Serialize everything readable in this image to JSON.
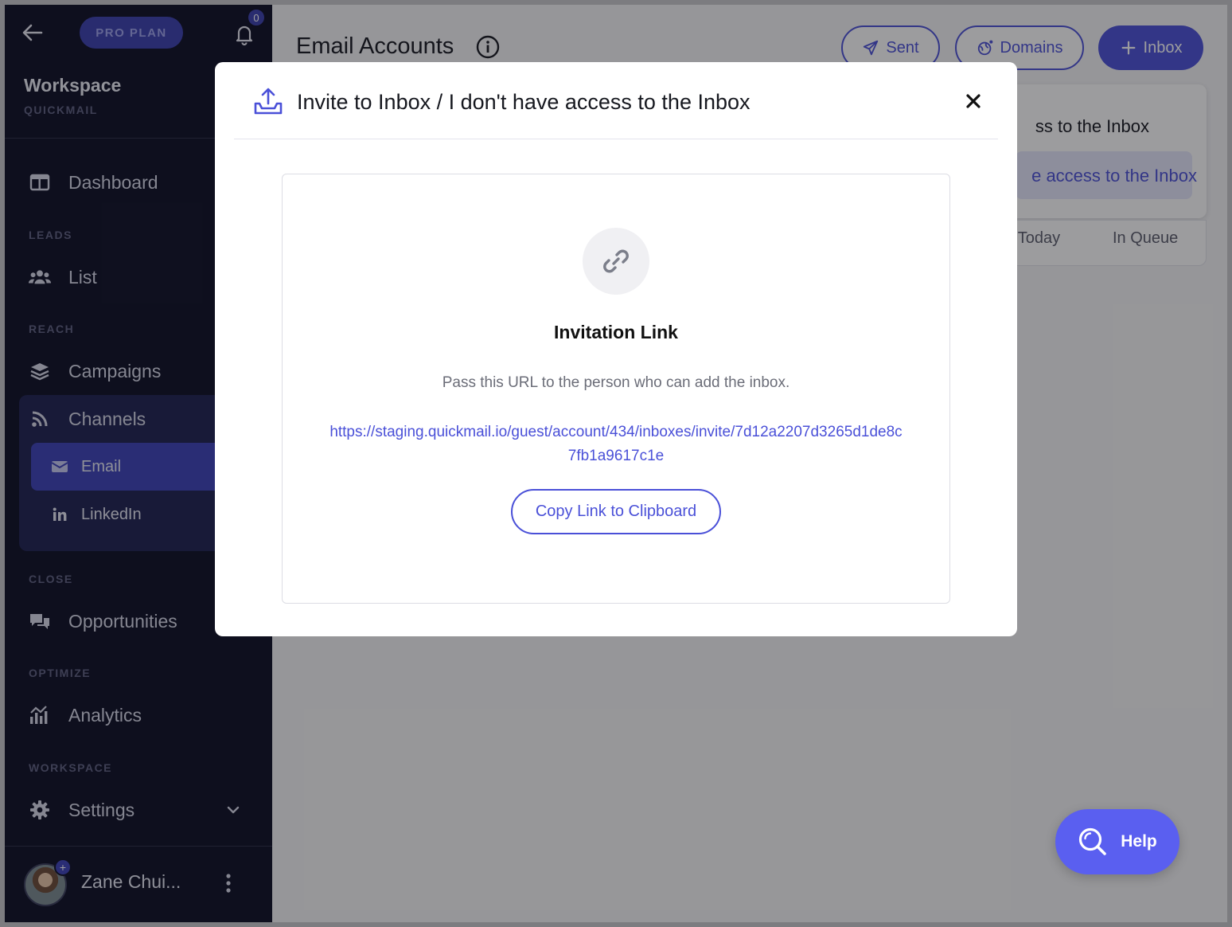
{
  "sidebar": {
    "plan_badge": "PRO PLAN",
    "notification_count": "0",
    "workspace_title": "Workspace",
    "workspace_sub": "QUICKMAIL",
    "dashboard": "Dashboard",
    "section_leads": "LEADS",
    "list": "List",
    "section_reach": "REACH",
    "campaigns": "Campaigns",
    "channels": "Channels",
    "email": "Email",
    "linkedin": "LinkedIn",
    "section_close": "CLOSE",
    "opportunities": "Opportunities",
    "section_optimize": "OPTIMIZE",
    "analytics": "Analytics",
    "section_workspace": "WORKSPACE",
    "settings": "Settings",
    "user_name": "Zane Chui..."
  },
  "main": {
    "title": "Email Accounts",
    "btn_sent": "Sent",
    "btn_domains": "Domains",
    "btn_inbox": "Inbox",
    "dropdown_item1": "ss to the Inbox",
    "dropdown_item2": "e access to the Inbox",
    "col_today": ": Today",
    "col_in_queue": "In Queue"
  },
  "modal": {
    "title": "Invite to Inbox / I don't have access to the Inbox",
    "heading": "Invitation Link",
    "description": "Pass this URL to the person who can add the inbox.",
    "url": "https://staging.quickmail.io/guest/account/434/inboxes/invite/7d12a2207d3265d1de8c7fb1a9617c1e",
    "copy_button": "Copy Link to Clipboard"
  },
  "help": {
    "label": "Help"
  },
  "colors": {
    "sidebar_bg": "#0b0d24",
    "accent": "#4a50d8",
    "active_item": "#3b41b8",
    "help_button": "#5a5ff0"
  },
  "icons": {
    "back": "arrow-left-icon",
    "notifications": "bell-icon",
    "dashboard": "columns-icon",
    "list": "users-icon",
    "campaigns": "layers-icon",
    "channels": "rss-icon",
    "email": "envelope-icon",
    "linkedin": "linkedin-icon",
    "opportunities": "comments-icon",
    "analytics": "chart-icon",
    "settings": "gear-icon",
    "info": "info-icon",
    "sent": "paper-plane-icon",
    "domains": "globe-icon",
    "inbox": "plus-icon",
    "modal_header": "inbox-upload-icon",
    "close": "close-icon",
    "link": "link-icon",
    "help": "search-icon"
  }
}
